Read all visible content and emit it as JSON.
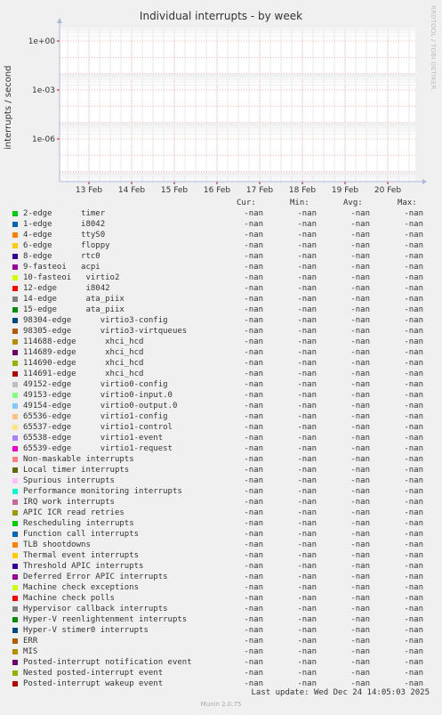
{
  "chart_data": {
    "type": "line",
    "title": "Individual interrupts - by week",
    "ylabel": "interrupts / second",
    "yscale": "log",
    "y_ticks": [
      "1e+00",
      "1e-03",
      "1e-06"
    ],
    "x_ticks": [
      "13 Feb",
      "14 Feb",
      "15 Feb",
      "16 Feb",
      "17 Feb",
      "18 Feb",
      "19 Feb",
      "20 Feb"
    ],
    "grid": true,
    "columns": [
      "Cur:",
      "Min:",
      "Avg:",
      "Max:"
    ],
    "series": [
      {
        "name": "2-edge      timer",
        "color": "#00cc00",
        "cur": "-nan",
        "min": "-nan",
        "avg": "-nan",
        "max": "-nan"
      },
      {
        "name": "1-edge      i8042",
        "color": "#0066b3",
        "cur": "-nan",
        "min": "-nan",
        "avg": "-nan",
        "max": "-nan"
      },
      {
        "name": "4-edge      ttyS0",
        "color": "#ff8000",
        "cur": "-nan",
        "min": "-nan",
        "avg": "-nan",
        "max": "-nan"
      },
      {
        "name": "6-edge      floppy",
        "color": "#ffcc00",
        "cur": "-nan",
        "min": "-nan",
        "avg": "-nan",
        "max": "-nan"
      },
      {
        "name": "8-edge      rtc0",
        "color": "#330099",
        "cur": "-nan",
        "min": "-nan",
        "avg": "-nan",
        "max": "-nan"
      },
      {
        "name": "9-fasteoi   acpi",
        "color": "#990099",
        "cur": "-nan",
        "min": "-nan",
        "avg": "-nan",
        "max": "-nan"
      },
      {
        "name": "10-fasteoi   virtio2",
        "color": "#ccff00",
        "cur": "-nan",
        "min": "-nan",
        "avg": "-nan",
        "max": "-nan"
      },
      {
        "name": "12-edge      i8042",
        "color": "#ff0000",
        "cur": "-nan",
        "min": "-nan",
        "avg": "-nan",
        "max": "-nan"
      },
      {
        "name": "14-edge      ata_piix",
        "color": "#808080",
        "cur": "-nan",
        "min": "-nan",
        "avg": "-nan",
        "max": "-nan"
      },
      {
        "name": "15-edge      ata_piix",
        "color": "#008f00",
        "cur": "-nan",
        "min": "-nan",
        "avg": "-nan",
        "max": "-nan"
      },
      {
        "name": "98304-edge      virtio3-config",
        "color": "#00487d",
        "cur": "-nan",
        "min": "-nan",
        "avg": "-nan",
        "max": "-nan"
      },
      {
        "name": "98305-edge      virtio3-virtqueues",
        "color": "#b35a00",
        "cur": "-nan",
        "min": "-nan",
        "avg": "-nan",
        "max": "-nan"
      },
      {
        "name": "114688-edge      xhci_hcd",
        "color": "#b38f00",
        "cur": "-nan",
        "min": "-nan",
        "avg": "-nan",
        "max": "-nan"
      },
      {
        "name": "114689-edge      xhci_hcd",
        "color": "#6b006b",
        "cur": "-nan",
        "min": "-nan",
        "avg": "-nan",
        "max": "-nan"
      },
      {
        "name": "114690-edge      xhci_hcd",
        "color": "#8fb300",
        "cur": "-nan",
        "min": "-nan",
        "avg": "-nan",
        "max": "-nan"
      },
      {
        "name": "114691-edge      xhci_hcd",
        "color": "#b30000",
        "cur": "-nan",
        "min": "-nan",
        "avg": "-nan",
        "max": "-nan"
      },
      {
        "name": "49152-edge      virtio0-config",
        "color": "#bebebe",
        "cur": "-nan",
        "min": "-nan",
        "avg": "-nan",
        "max": "-nan"
      },
      {
        "name": "49153-edge      virtio0-input.0",
        "color": "#80ff80",
        "cur": "-nan",
        "min": "-nan",
        "avg": "-nan",
        "max": "-nan"
      },
      {
        "name": "49154-edge      virtio0-output.0",
        "color": "#80c9ff",
        "cur": "-nan",
        "min": "-nan",
        "avg": "-nan",
        "max": "-nan"
      },
      {
        "name": "65536-edge      virtio1-config",
        "color": "#ffc080",
        "cur": "-nan",
        "min": "-nan",
        "avg": "-nan",
        "max": "-nan"
      },
      {
        "name": "65537-edge      virtio1-control",
        "color": "#ffe680",
        "cur": "-nan",
        "min": "-nan",
        "avg": "-nan",
        "max": "-nan"
      },
      {
        "name": "65538-edge      virtio1-event",
        "color": "#aa80ff",
        "cur": "-nan",
        "min": "-nan",
        "avg": "-nan",
        "max": "-nan"
      },
      {
        "name": "65539-edge      virtio1-request",
        "color": "#ee00cc",
        "cur": "-nan",
        "min": "-nan",
        "avg": "-nan",
        "max": "-nan"
      },
      {
        "name": "Non-maskable interrupts",
        "color": "#ff8080",
        "cur": "-nan",
        "min": "-nan",
        "avg": "-nan",
        "max": "-nan"
      },
      {
        "name": "Local timer interrupts",
        "color": "#666600",
        "cur": "-nan",
        "min": "-nan",
        "avg": "-nan",
        "max": "-nan"
      },
      {
        "name": "Spurious interrupts",
        "color": "#ffbfff",
        "cur": "-nan",
        "min": "-nan",
        "avg": "-nan",
        "max": "-nan"
      },
      {
        "name": "Performance monitoring interrupts",
        "color": "#00ffcc",
        "cur": "-nan",
        "min": "-nan",
        "avg": "-nan",
        "max": "-nan"
      },
      {
        "name": "IRQ work interrupts",
        "color": "#cc6699",
        "cur": "-nan",
        "min": "-nan",
        "avg": "-nan",
        "max": "-nan"
      },
      {
        "name": "APIC ICR read retries",
        "color": "#999900",
        "cur": "-nan",
        "min": "-nan",
        "avg": "-nan",
        "max": "-nan"
      },
      {
        "name": "Rescheduling interrupts",
        "color": "#00cc00",
        "cur": "-nan",
        "min": "-nan",
        "avg": "-nan",
        "max": "-nan"
      },
      {
        "name": "Function call interrupts",
        "color": "#0066b3",
        "cur": "-nan",
        "min": "-nan",
        "avg": "-nan",
        "max": "-nan"
      },
      {
        "name": "TLB shootdowns",
        "color": "#ff8000",
        "cur": "-nan",
        "min": "-nan",
        "avg": "-nan",
        "max": "-nan"
      },
      {
        "name": "Thermal event interrupts",
        "color": "#ffcc00",
        "cur": "-nan",
        "min": "-nan",
        "avg": "-nan",
        "max": "-nan"
      },
      {
        "name": "Threshold APIC interrupts",
        "color": "#330099",
        "cur": "-nan",
        "min": "-nan",
        "avg": "-nan",
        "max": "-nan"
      },
      {
        "name": "Deferred Error APIC interrupts",
        "color": "#990099",
        "cur": "-nan",
        "min": "-nan",
        "avg": "-nan",
        "max": "-nan"
      },
      {
        "name": "Machine check exceptions",
        "color": "#ccff00",
        "cur": "-nan",
        "min": "-nan",
        "avg": "-nan",
        "max": "-nan"
      },
      {
        "name": "Machine check polls",
        "color": "#ff0000",
        "cur": "-nan",
        "min": "-nan",
        "avg": "-nan",
        "max": "-nan"
      },
      {
        "name": "Hypervisor callback interrupts",
        "color": "#808080",
        "cur": "-nan",
        "min": "-nan",
        "avg": "-nan",
        "max": "-nan"
      },
      {
        "name": "Hyper-V reenlightenment interrupts",
        "color": "#008f00",
        "cur": "-nan",
        "min": "-nan",
        "avg": "-nan",
        "max": "-nan"
      },
      {
        "name": "Hyper-V stimer0 interrupts",
        "color": "#00487d",
        "cur": "-nan",
        "min": "-nan",
        "avg": "-nan",
        "max": "-nan"
      },
      {
        "name": "ERR",
        "color": "#b35a00",
        "cur": "-nan",
        "min": "-nan",
        "avg": "-nan",
        "max": "-nan"
      },
      {
        "name": "MIS",
        "color": "#b38f00",
        "cur": "-nan",
        "min": "-nan",
        "avg": "-nan",
        "max": "-nan"
      },
      {
        "name": "Posted-interrupt notification event",
        "color": "#6b006b",
        "cur": "-nan",
        "min": "-nan",
        "avg": "-nan",
        "max": "-nan"
      },
      {
        "name": "Nested posted-interrupt event",
        "color": "#8fb300",
        "cur": "-nan",
        "min": "-nan",
        "avg": "-nan",
        "max": "-nan"
      },
      {
        "name": "Posted-interrupt wakeup event",
        "color": "#b30000",
        "cur": "-nan",
        "min": "-nan",
        "avg": "-nan",
        "max": "-nan"
      }
    ]
  },
  "side_label": "RRDTOOL / TOBI OETIKER",
  "last_update": "Last update: Wed Dec 24 14:05:03 2025",
  "footer": "Munin 2.0.75"
}
